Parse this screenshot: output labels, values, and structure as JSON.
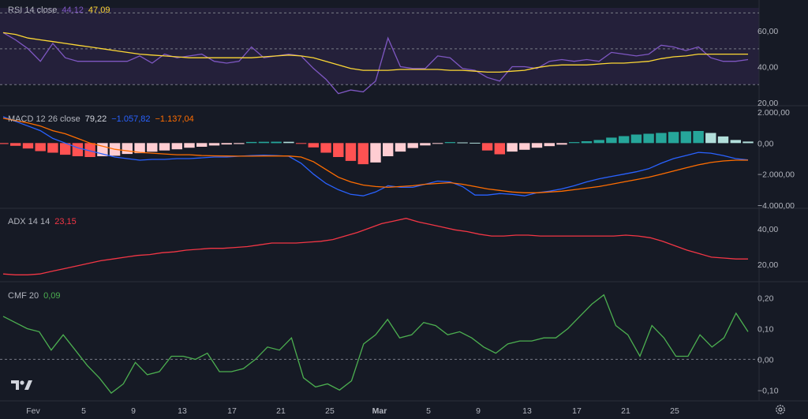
{
  "window": {
    "logo_icon": "tradingview-logo-icon",
    "settings_icon": "gear-icon"
  },
  "x_axis": {
    "labels": [
      "Fev",
      "5",
      "9",
      "13",
      "17",
      "21",
      "25",
      "Mar",
      "5",
      "9",
      "13",
      "17",
      "21",
      "25"
    ]
  },
  "chart_data": [
    {
      "type": "line",
      "name": "RSI",
      "header": "RSI 14 close",
      "legend_values": [
        "44,12",
        "47,09"
      ],
      "series": [
        {
          "name": "RSI",
          "color": "#7e57c2",
          "values": [
            59,
            55,
            50,
            43,
            53,
            45,
            43,
            43,
            43,
            43,
            43,
            46,
            42,
            47,
            45,
            46,
            47,
            43,
            42,
            43,
            51,
            45,
            46,
            47,
            46,
            39,
            33,
            25,
            27,
            26,
            32,
            56,
            40,
            39,
            39,
            46,
            45,
            39,
            38,
            34,
            32,
            40,
            40,
            39,
            43,
            44,
            43,
            44,
            43,
            48,
            47,
            46,
            47,
            52,
            51,
            49,
            51,
            45,
            43,
            43,
            44
          ]
        },
        {
          "name": "MA",
          "color": "#fdd835",
          "values": [
            59,
            58,
            56,
            55,
            54,
            53,
            52,
            51,
            50,
            49,
            48,
            47,
            46.5,
            46,
            45.5,
            45,
            45,
            45,
            45,
            45,
            45,
            45.5,
            46,
            46.5,
            46,
            45,
            43,
            41,
            39,
            38,
            38,
            38,
            38.5,
            38.5,
            38.5,
            38.5,
            38,
            38,
            37.5,
            37,
            37,
            37.5,
            38,
            39.5,
            40.5,
            41,
            41,
            41,
            41.5,
            42,
            42,
            42.5,
            43,
            44.5,
            45.5,
            46,
            47,
            47,
            47,
            47,
            47
          ]
        }
      ],
      "bands": [
        70,
        50,
        30
      ],
      "yaxis": [
        "60,00",
        "40,00",
        "20,00"
      ],
      "yticks": [
        60,
        40,
        20
      ],
      "ylim": [
        20,
        75
      ]
    },
    {
      "type": "bar+line",
      "name": "MACD",
      "header": "MACD 12 26 close",
      "legend_values": [
        "79,22",
        "−1.057,82",
        "−1.137,04"
      ],
      "histogram": [
        -60,
        -180,
        -350,
        -520,
        -620,
        -750,
        -850,
        -900,
        -850,
        -820,
        -700,
        -650,
        -560,
        -480,
        -400,
        -300,
        -240,
        -160,
        -90,
        -60,
        70,
        80,
        90,
        80,
        -20,
        -280,
        -620,
        -900,
        -1150,
        -1360,
        -1250,
        -850,
        -550,
        -320,
        -150,
        -40,
        60,
        40,
        20,
        -480,
        -720,
        -550,
        -430,
        -300,
        -200,
        -100,
        60,
        120,
        200,
        350,
        450,
        550,
        600,
        650,
        720,
        760,
        780,
        650,
        430,
        200,
        100
      ],
      "hist_colors": {
        "pos_up": "#26a69a",
        "pos_down": "#b2dfdb",
        "neg_down": "#ff5252",
        "neg_up": "#ffcdd2"
      },
      "series": [
        {
          "name": "MACD",
          "color": "#2962ff",
          "values": [
            1700,
            1400,
            1100,
            800,
            300,
            0,
            -300,
            -500,
            -700,
            -900,
            -1000,
            -1100,
            -1050,
            -1050,
            -1000,
            -1000,
            -950,
            -900,
            -900,
            -850,
            -800,
            -780,
            -800,
            -850,
            -1300,
            -2000,
            -2600,
            -3000,
            -3300,
            -3400,
            -3150,
            -2750,
            -2850,
            -2850,
            -2650,
            -2450,
            -2500,
            -2800,
            -3350,
            -3350,
            -3250,
            -3300,
            -3400,
            -3200,
            -3100,
            -2950,
            -2750,
            -2500,
            -2300,
            -2150,
            -2000,
            -1850,
            -1650,
            -1300,
            -1000,
            -800,
            -600,
            -650,
            -800,
            -1000,
            -1080
          ]
        },
        {
          "name": "Signal",
          "color": "#ff6d00",
          "values": [
            1600,
            1450,
            1300,
            1100,
            800,
            600,
            300,
            0,
            -200,
            -400,
            -500,
            -600,
            -650,
            -700,
            -750,
            -750,
            -800,
            -820,
            -830,
            -840,
            -840,
            -830,
            -830,
            -830,
            -900,
            -1200,
            -1700,
            -2200,
            -2500,
            -2700,
            -2800,
            -2850,
            -2800,
            -2750,
            -2650,
            -2600,
            -2550,
            -2650,
            -2800,
            -2950,
            -3050,
            -3150,
            -3200,
            -3200,
            -3150,
            -3100,
            -3000,
            -2900,
            -2800,
            -2650,
            -2500,
            -2350,
            -2200,
            -2000,
            -1800,
            -1600,
            -1400,
            -1250,
            -1150,
            -1100,
            -1100
          ]
        }
      ],
      "yaxis": [
        "2.000,00",
        "0,00",
        "−2.000,00",
        "−4.000,00"
      ],
      "yticks": [
        2000,
        0,
        -2000,
        -4000
      ],
      "ylim": [
        -4100,
        2100
      ]
    },
    {
      "type": "line",
      "name": "ADX",
      "header": "ADX 14 14",
      "legend_values": [
        "23,15"
      ],
      "series": [
        {
          "name": "ADX",
          "color": "#f23645",
          "values": [
            14.5,
            14,
            14,
            14.5,
            16,
            17.5,
            19,
            20.5,
            22,
            23,
            24,
            25,
            25.5,
            26.5,
            27,
            28,
            28.5,
            29,
            29,
            29.5,
            30,
            31,
            32,
            32,
            32,
            32.5,
            33,
            34,
            36,
            38,
            40.5,
            43,
            44.5,
            46,
            44,
            42.5,
            41,
            39.5,
            38.5,
            37,
            36,
            36,
            36.5,
            36.5,
            36,
            36,
            36,
            36,
            36,
            36,
            36,
            36.5,
            36,
            35,
            33,
            30.5,
            28,
            26,
            24,
            23.5,
            23,
            23
          ]
        }
      ],
      "yaxis": [
        "40,00",
        "20,00"
      ],
      "yticks": [
        40,
        20
      ],
      "ylim": [
        11,
        49
      ]
    },
    {
      "type": "line",
      "name": "CMF",
      "header": "CMF 20",
      "legend_values": [
        "0,09"
      ],
      "series": [
        {
          "name": "CMF",
          "color": "#4caf50",
          "values": [
            0.14,
            0.12,
            0.1,
            0.09,
            0.03,
            0.08,
            0.03,
            -0.02,
            -0.06,
            -0.11,
            -0.08,
            -0.01,
            -0.05,
            -0.04,
            0.01,
            0.01,
            0.0,
            0.02,
            -0.04,
            -0.04,
            -0.03,
            0.0,
            0.04,
            0.03,
            0.07,
            -0.06,
            -0.09,
            -0.08,
            -0.1,
            -0.07,
            0.05,
            0.08,
            0.13,
            0.07,
            0.08,
            0.12,
            0.11,
            0.08,
            0.09,
            0.07,
            0.04,
            0.02,
            0.05,
            0.06,
            0.06,
            0.07,
            0.07,
            0.1,
            0.14,
            0.18,
            0.21,
            0.11,
            0.08,
            0.01,
            0.11,
            0.07,
            0.01,
            0.01,
            0.08,
            0.04,
            0.07,
            0.15,
            0.09
          ]
        }
      ],
      "zero_line": true,
      "yaxis": [
        "0,20",
        "0,10",
        "0,00",
        "−0,10"
      ],
      "yticks": [
        0.2,
        0.1,
        0.0,
        -0.1
      ],
      "ylim": [
        -0.13,
        0.24
      ]
    }
  ]
}
